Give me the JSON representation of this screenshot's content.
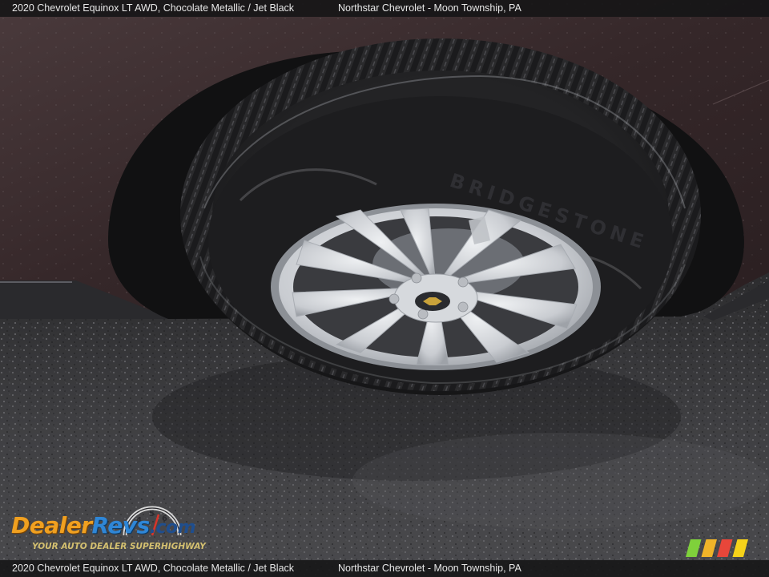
{
  "caption": {
    "vehicle": "2020 Chevrolet Equinox LT AWD,   Chocolate Metallic / Jet Black",
    "dealer": "Northstar Chevrolet - Moon Township, PA"
  },
  "watermark": {
    "brand_part1": "Dealer",
    "brand_part2": "Revs",
    "brand_part3": ".com",
    "tagline": "YOUR AUTO DEALER SUPERHIGHWAY",
    "gauge_digits": [
      "4",
      "5",
      "6"
    ]
  },
  "photo": {
    "subject": "wheel-and-tire",
    "tire_sidewall_text": "BRIDGESTONE",
    "colors": {
      "body_paint": "#3a2c2e",
      "asphalt": "#3c3c3e",
      "rim": "#cfd2d6",
      "tire": "#1c1c1e"
    }
  },
  "brand_stripes": [
    "#7fd13b",
    "#f0b429",
    "#e8463a",
    "#f6d21a"
  ]
}
